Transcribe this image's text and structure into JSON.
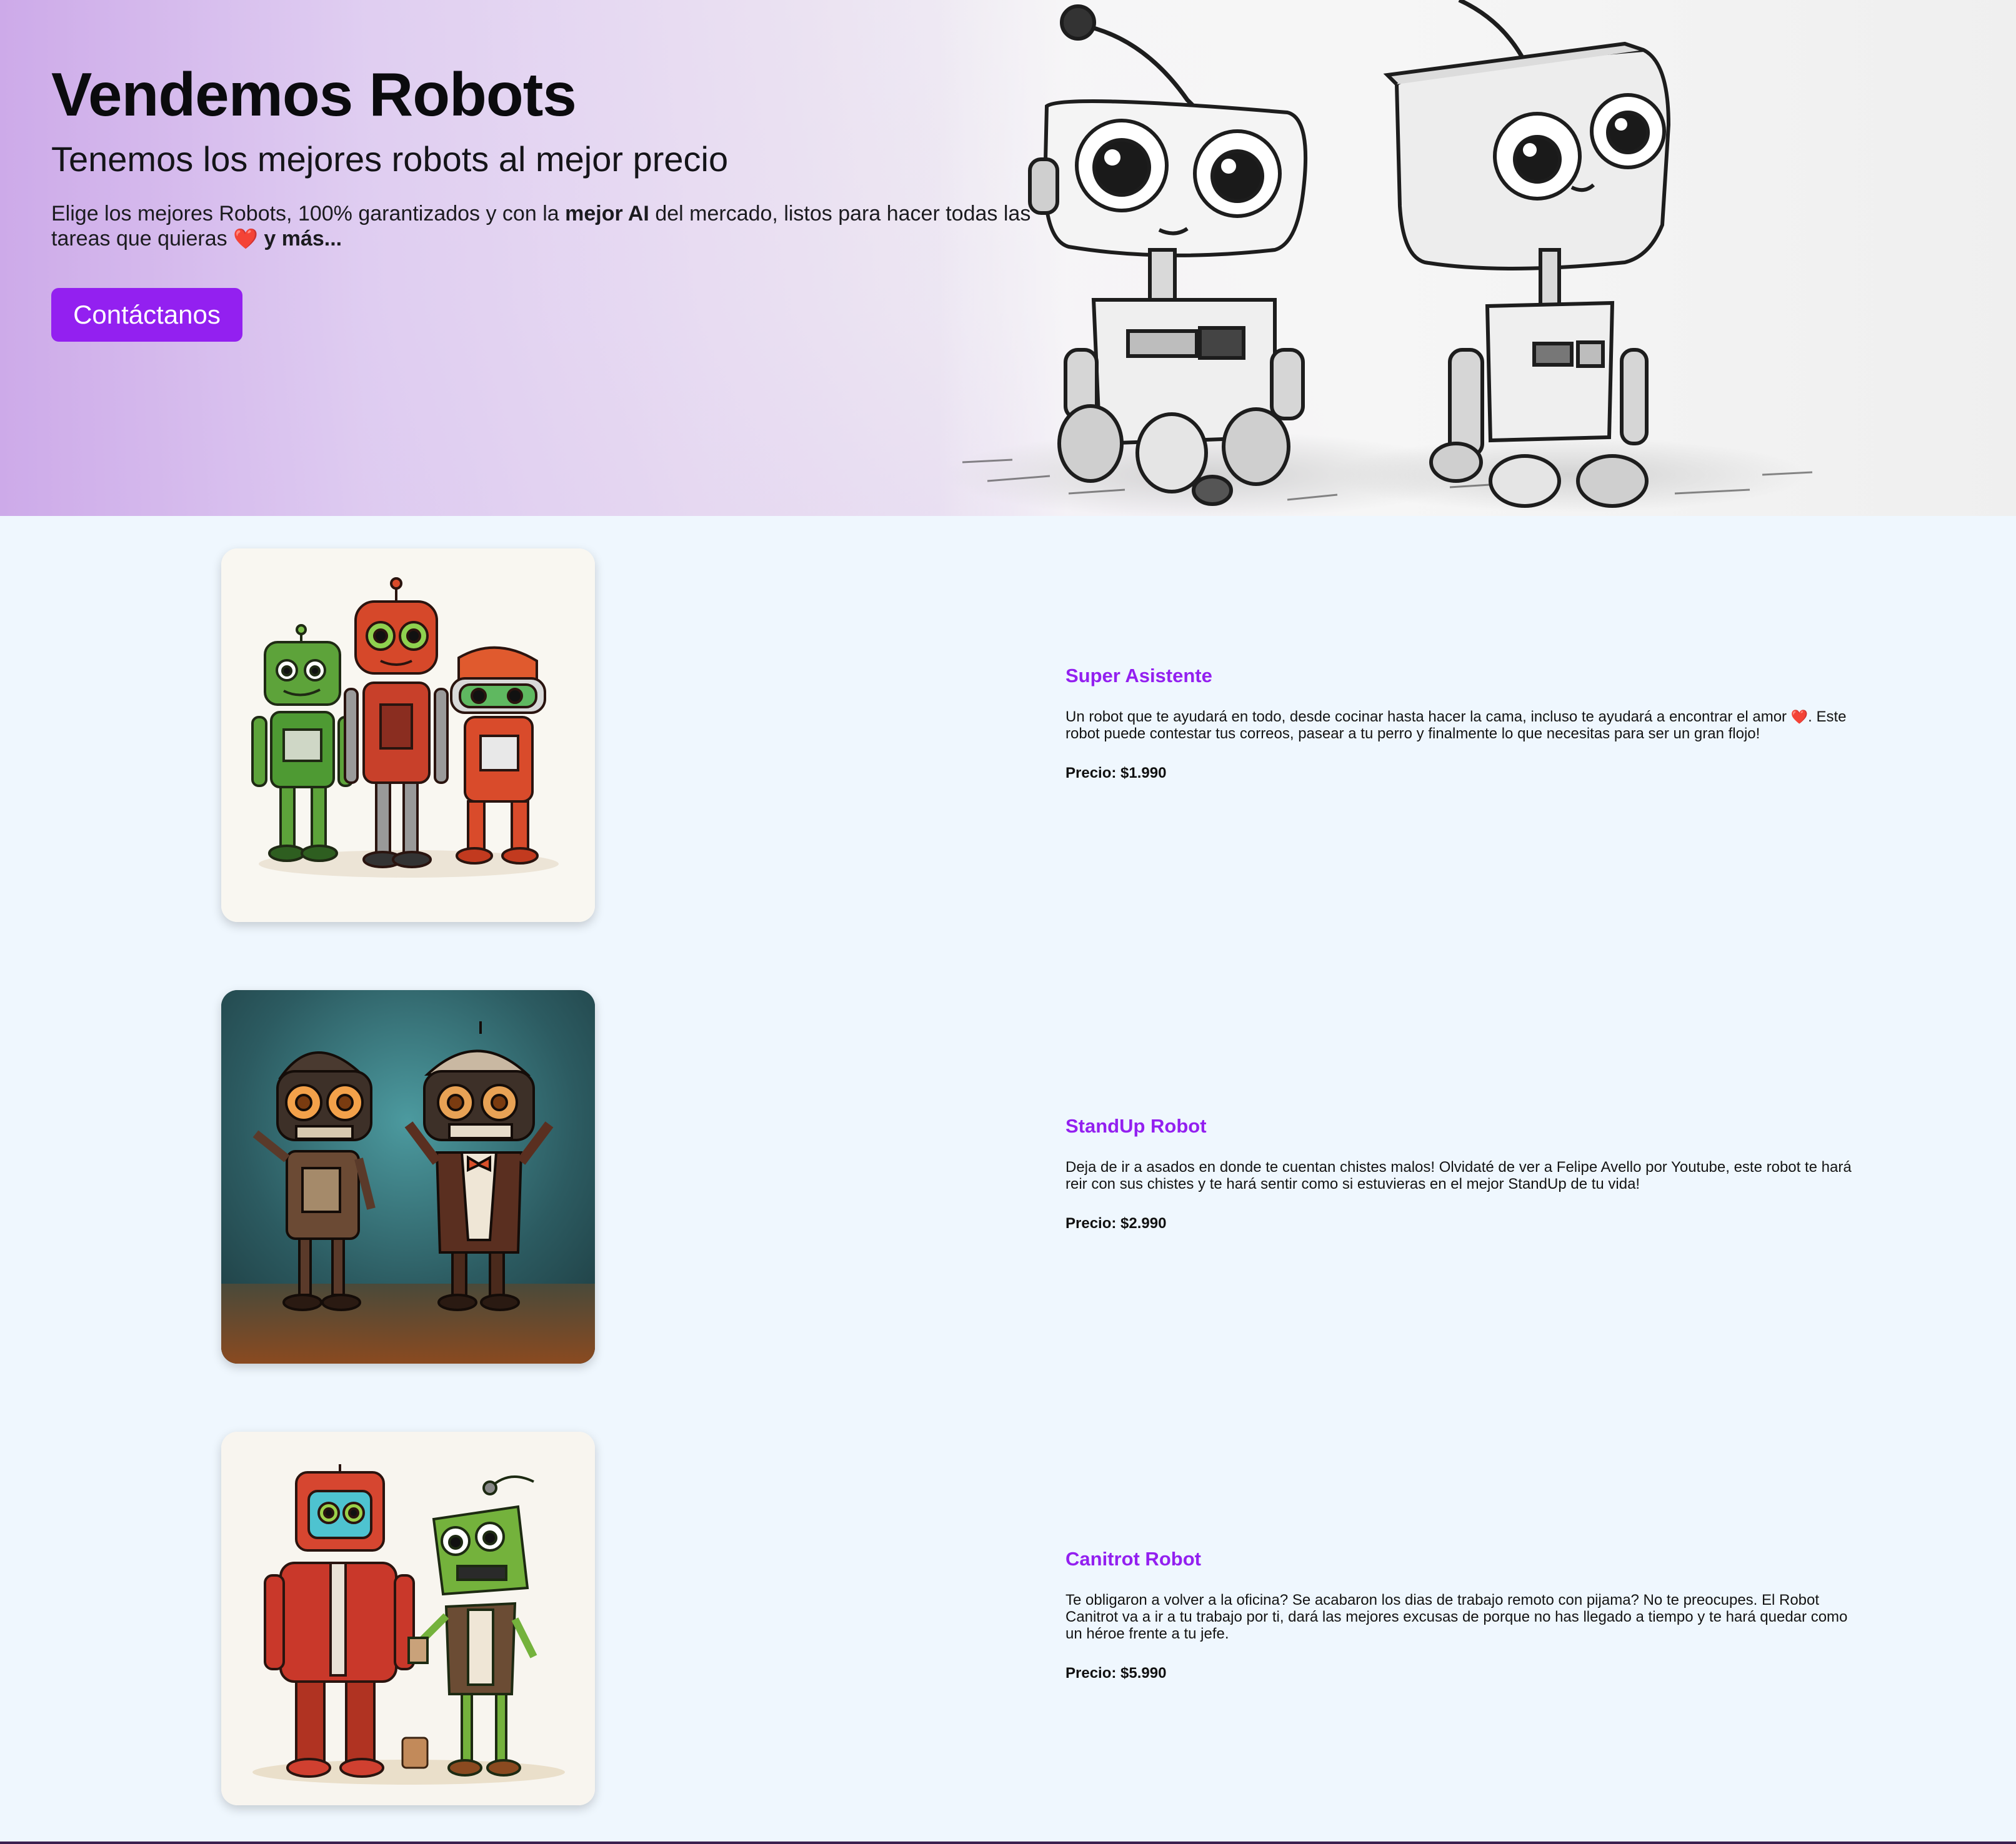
{
  "hero": {
    "title": "Vendemos Robots",
    "subtitle": "Tenemos los mejores robots al mejor precio",
    "text_part1": "Elige los mejores Robots, 100% garantizados y con la ",
    "text_bold1": "mejor AI",
    "text_part2": " del mercado, listos para hacer todas las tareas que quieras ",
    "text_heart": "❤️",
    "text_bold2": " y más...",
    "cta_label": "Contáctanos",
    "image_icon": "two-sketch-robots-illustration"
  },
  "products": [
    {
      "name": "Super Asistente",
      "desc_part1": "Un robot que te ayudará en todo, desde cocinar hasta hacer la cama, incluso te ayudará a encontrar el amor ",
      "desc_heart": "❤️",
      "desc_part2": ". Este robot puede contestar tus correos, pasear a tu perro y finalmente lo que necesitas para ser un gran flojo!",
      "price": "Precio: $1.990",
      "image_icon": "three-robots-illustration"
    },
    {
      "name": "StandUp Robot",
      "desc_part1": "Deja de ir a asados en donde te cuentan chistes malos! Olvidaté de ver a Felipe Avello por Youtube, este robot te hará reir con sus chistes y te hará sentir como si estuvieras en el mejor StandUp de tu vida!",
      "price": "Precio: $2.990",
      "image_icon": "two-comedian-robots-illustration"
    },
    {
      "name": "Canitrot Robot",
      "desc_part1": "Te obligaron a volver a la oficina? Se acabaron los dias de trabajo remoto con pijama? No te preocupes. El Robot Canitrot va a ir a tu trabajo por ti, dará las mejores excusas de porque no has llegado a tiempo y te hará quedar como un héroe frente a tu jefe.",
      "price": "Precio: $5.990",
      "image_icon": "two-office-robots-illustration"
    }
  ],
  "colors": {
    "accent": "#9320f0",
    "page_background": "#eff7fe",
    "heart": "#e02b2b"
  }
}
